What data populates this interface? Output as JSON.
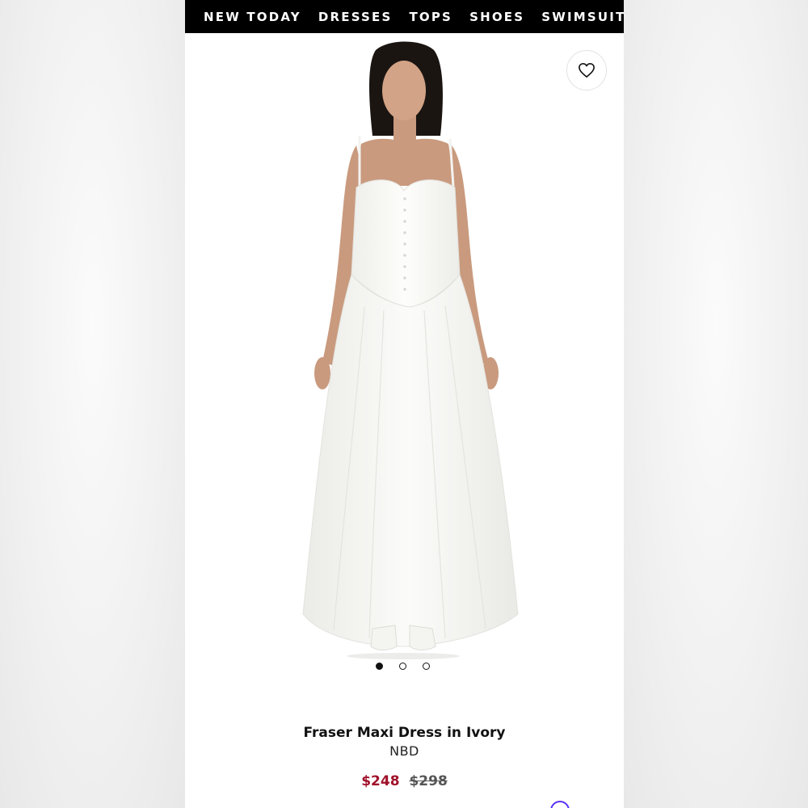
{
  "nav": {
    "items": [
      "NEW TODAY",
      "DRESSES",
      "TOPS",
      "SHOES",
      "SWIMSUITS"
    ]
  },
  "product": {
    "title": "Fraser Maxi Dress in Ivory",
    "brand": "NBD",
    "price_sale": "$248",
    "price_original": "$298",
    "image_alt": "Model wearing ivory maxi dress"
  },
  "gallery": {
    "image_count": 3,
    "active_index": 0
  },
  "icons": {
    "favorite": "heart-outline-icon"
  },
  "colors": {
    "nav_bg": "#000000",
    "sale_price": "#a0102a",
    "promo_accent": "#5a31f4"
  }
}
